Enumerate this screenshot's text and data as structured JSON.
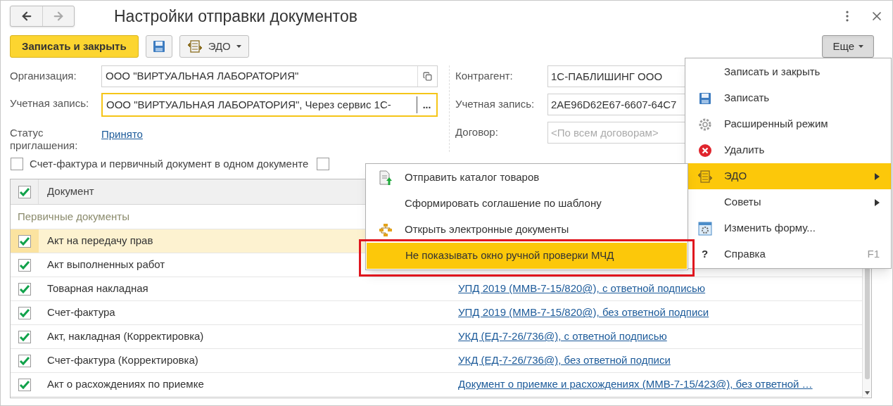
{
  "window": {
    "title": "Настройки отправки документов"
  },
  "toolbar": {
    "primary": "Записать и закрыть",
    "edo": "ЭДО",
    "more": "Еще",
    "more_pressed": true
  },
  "fields_left": [
    {
      "kind": "open",
      "label": "Организация:",
      "value": "ООО \"ВИРТУАЛЬНАЯ ЛАБОРАТОРИЯ\"",
      "focused": false
    },
    {
      "kind": "choice",
      "label": "Учетная запись:",
      "value": "ООО \"ВИРТУАЛЬНАЯ ЛАБОРАТОРИЯ\", Через сервис 1С-",
      "button_text": "...",
      "focused": true
    },
    {
      "kind": "link",
      "label": "Статус приглашения:",
      "value": "Принято"
    }
  ],
  "fields_right": [
    {
      "label": "Контрагент:",
      "value": "1С-ПАБЛИШИНГ ООО"
    },
    {
      "label": "Учетная запись:",
      "value": "2AE96D62E67-6607-64C7"
    },
    {
      "label": "Договор:",
      "placeholder": "<По всем договорам>"
    }
  ],
  "options": [
    {
      "label": "Счет-фактура и первичный документ в одном документе",
      "checked": false
    },
    {
      "checked": false
    }
  ],
  "table": {
    "columns": [
      "Документ"
    ],
    "all_checked": true,
    "group": "Первичные документы",
    "rows": [
      {
        "checked": true,
        "selected": true,
        "document": "Акт на передачу прав"
      },
      {
        "checked": true,
        "selected": false,
        "document": "Акт выполненных работ"
      },
      {
        "checked": true,
        "selected": false,
        "document": "Товарная накладная",
        "format": "УПД 2019 (ММВ-7-15/820@), с ответной подписью"
      },
      {
        "checked": true,
        "selected": false,
        "document": "Счет-фактура",
        "format": "УПД 2019 (ММВ-7-15/820@), без ответной подписи"
      },
      {
        "checked": true,
        "selected": false,
        "document": "Акт, накладная (Корректировка)",
        "format": "УКД (ЕД-7-26/736@), с ответной подписью"
      },
      {
        "checked": true,
        "selected": false,
        "document": "Счет-фактура (Корректировка)",
        "format": "УКД (ЕД-7-26/736@), без ответной подписи"
      },
      {
        "checked": true,
        "selected": false,
        "document": "Акт о расхождениях по приемке",
        "format": "Документ о приемке и расхождениях (ММВ-7-15/423@), без ответной …"
      }
    ]
  },
  "menu": {
    "items": [
      {
        "label": "Записать и закрыть",
        "kind": "plain",
        "selected": false
      },
      {
        "label": "Записать",
        "kind": "save",
        "selected": false
      },
      {
        "label": "Расширенный режим",
        "kind": "gear",
        "selected": false
      },
      {
        "label": "Удалить",
        "kind": "delete",
        "selected": false
      },
      {
        "label": "ЭДО",
        "kind": "edo",
        "selected": true,
        "submenu": true
      },
      {
        "label": "Советы",
        "kind": "plain",
        "selected": false,
        "submenu": true
      },
      {
        "label": "Изменить форму...",
        "kind": "form",
        "selected": false
      },
      {
        "label": "Справка",
        "glyph": "?",
        "shortcut": "F1",
        "selected": false
      }
    ]
  },
  "submenu": {
    "items": [
      {
        "label": "Отправить каталог товаров",
        "kind": "upload",
        "selected": false
      },
      {
        "label": "Сформировать соглашение по шаблону",
        "kind": "plain",
        "selected": false
      },
      {
        "label": "Открыть электронные документы",
        "kind": "tree",
        "selected": false
      },
      {
        "label": "Не показывать окно ручной проверки МЧД",
        "kind": "plain",
        "selected": true,
        "framed": true
      }
    ]
  }
}
